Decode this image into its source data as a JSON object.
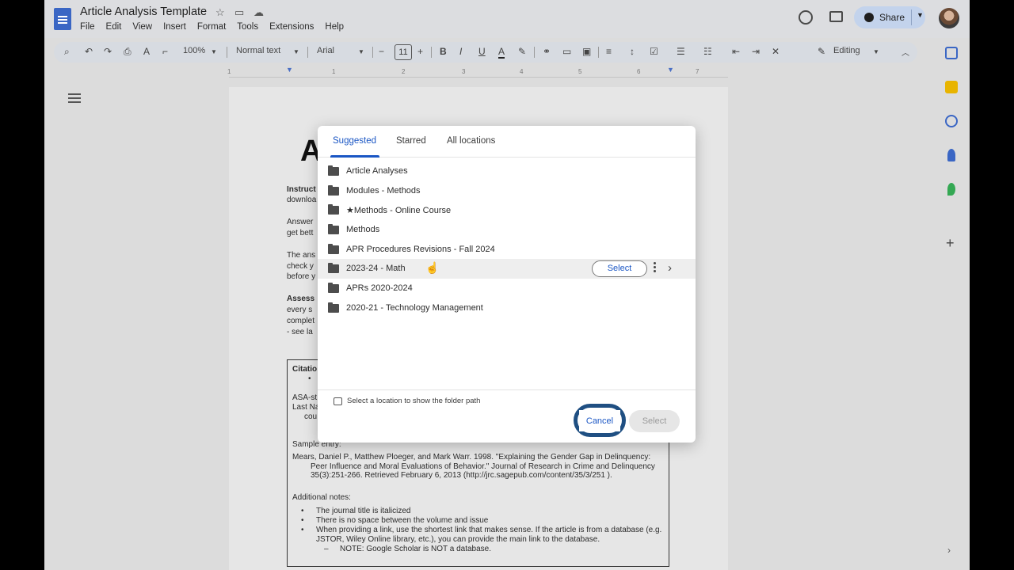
{
  "app": {
    "title": "Article Analysis Template",
    "menu": [
      "File",
      "Edit",
      "View",
      "Insert",
      "Format",
      "Tools",
      "Extensions",
      "Help"
    ],
    "share_label": "Share"
  },
  "toolbar": {
    "zoom": "100%",
    "style": "Normal text",
    "font": "Arial",
    "font_size": "11",
    "mode": "Editing"
  },
  "ruler": [
    "1",
    "1",
    "2",
    "3",
    "4",
    "5",
    "6",
    "7"
  ],
  "document": {
    "title_letter": "A",
    "lines": [
      "Instruct",
      "downloa",
      "Answer",
      "get bett",
      "The ans",
      "check y",
      "before y",
      "Assess",
      "every s",
      "complet",
      "- see la"
    ],
    "box": {
      "citation_label": "Citatio",
      "asa_line": "ASA-st",
      "lastname_line": "Last Na",
      "cou_line": "cou",
      "sample_label": "Sample entry:",
      "sample_1": "Mears, Daniel P., Matthew Ploeger, and Mark Warr. 1998. \"Explaining the Gender Gap in Delinquency:",
      "sample_2": "Peer Influence and Moral Evaluations of Behavior.\" Journal of Research in Crime and Delinquency",
      "sample_3": "35(3):251-266. Retrieved February 6, 2013 (http://jrc.sagepub.com/content/35/3/251 ).",
      "notes_label": "Additional notes:",
      "notes": [
        "The journal title is italicized",
        "There is no space between the volume and issue",
        "When providing a link, use the shortest link that makes sense. If the article is from a database (e.g.",
        "JSTOR, Wiley Online library, etc.), you can provide the main link to the database.",
        "NOTE: Google Scholar is NOT a database."
      ]
    }
  },
  "dialog": {
    "tabs": [
      "Suggested",
      "Starred",
      "All locations"
    ],
    "active_tab": "Suggested",
    "folders": [
      "Article Analyses",
      "Modules - Methods",
      "★Methods - Online Course",
      "Methods",
      "APR Procedures Revisions - Fall 2024",
      "2023-24 - Math",
      "APRs 2020-2024",
      "2020-21 - Technology Management"
    ],
    "hovered_folder": "2023-24 - Math",
    "row_select_label": "Select",
    "path_hint": "Select a location to show the folder path",
    "cancel_label": "Cancel",
    "select_label": "Select"
  },
  "colors": {
    "accent": "#1a56c4",
    "focus_ring": "#1f4f82",
    "share_bg": "#c3d3ec"
  }
}
